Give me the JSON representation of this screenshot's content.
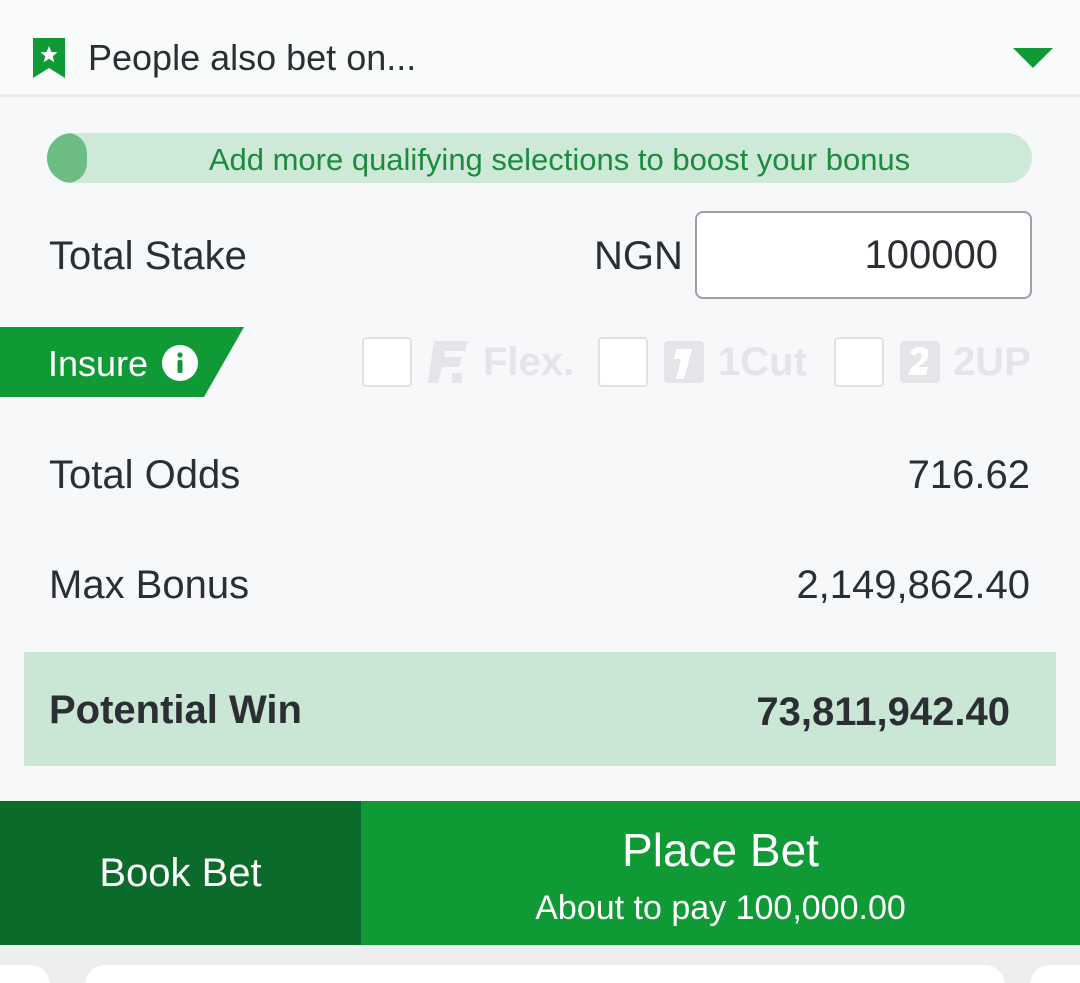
{
  "header": {
    "title": "People also bet on...",
    "icon": "bookmark-star-icon",
    "toggle_icon": "caret-down-icon"
  },
  "bonus_banner": {
    "text": "Add more qualifying selections to boost your bonus",
    "progress": 0.04
  },
  "stake": {
    "label": "Total Stake",
    "currency": "NGN",
    "value": "100000"
  },
  "insure": {
    "label": "Insure",
    "info_icon": "info-icon",
    "options": [
      {
        "label": "Flex.",
        "icon": "flex-icon",
        "checked": false
      },
      {
        "label": "1Cut",
        "icon": "one-cut-icon",
        "checked": false
      },
      {
        "label": "2UP",
        "icon": "two-up-icon",
        "checked": false
      }
    ]
  },
  "odds": {
    "label": "Total Odds",
    "value": "716.62"
  },
  "max_bonus": {
    "label": "Max Bonus",
    "value": "2,149,862.40"
  },
  "potential_win": {
    "label": "Potential Win",
    "value": "73,811,942.40"
  },
  "actions": {
    "book_bet": "Book Bet",
    "place_bet": "Place Bet",
    "place_bet_sub": "About to pay 100,000.00"
  },
  "colors": {
    "brand_green": "#0f9a36",
    "dark_green": "#0b6b2a",
    "banner_bg": "#cfe9d8",
    "win_bg": "#cae6d4"
  }
}
